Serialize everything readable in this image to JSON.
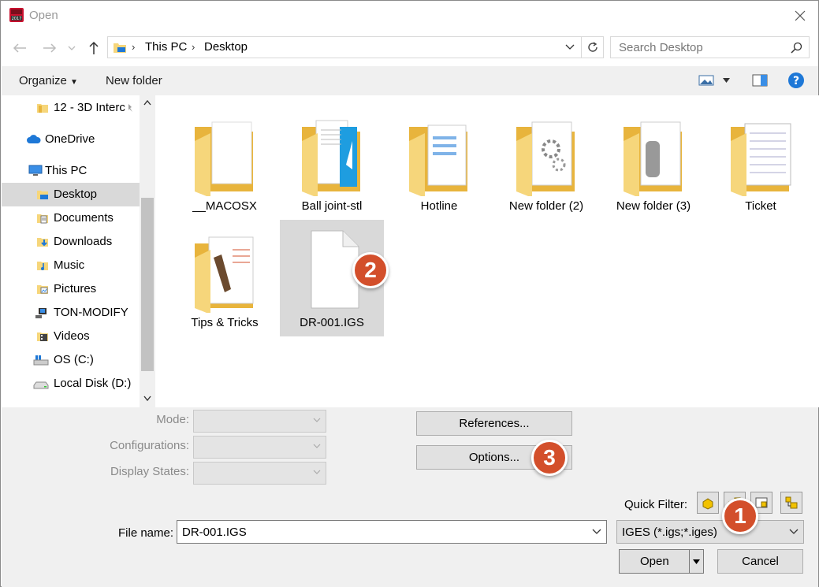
{
  "window": {
    "title": "Open"
  },
  "address": {
    "crumbs": [
      "This PC",
      "Desktop"
    ]
  },
  "search": {
    "placeholder": "Search Desktop"
  },
  "toolbar": {
    "organize_label": "Organize",
    "new_folder_label": "New folder"
  },
  "sidebar": {
    "items": [
      {
        "label": "12 - 3D Interc",
        "icon": "folder-icon"
      },
      {
        "label": "OneDrive",
        "icon": "cloud-icon"
      },
      {
        "label": "This PC",
        "icon": "computer-icon"
      },
      {
        "label": "Desktop",
        "icon": "desktop-folder-icon",
        "selected": true
      },
      {
        "label": "Documents",
        "icon": "documents-icon"
      },
      {
        "label": "Downloads",
        "icon": "downloads-icon"
      },
      {
        "label": "Music",
        "icon": "music-icon"
      },
      {
        "label": "Pictures",
        "icon": "pictures-icon"
      },
      {
        "label": "TON-MODIFY",
        "icon": "network-drive-icon"
      },
      {
        "label": "Videos",
        "icon": "videos-icon"
      },
      {
        "label": "OS (C:)",
        "icon": "windows-drive-icon"
      },
      {
        "label": "Local Disk (D:)",
        "icon": "disk-icon"
      }
    ]
  },
  "files": [
    {
      "name": "__MACOSX",
      "kind": "folder"
    },
    {
      "name": "Ball joint-stl",
      "kind": "folder"
    },
    {
      "name": "Hotline",
      "kind": "folder"
    },
    {
      "name": "New folder (2)",
      "kind": "folder"
    },
    {
      "name": "New folder (3)",
      "kind": "folder"
    },
    {
      "name": "Ticket",
      "kind": "folder"
    },
    {
      "name": "Tips & Tricks",
      "kind": "folder"
    },
    {
      "name": "DR-001.IGS",
      "kind": "file",
      "selected": true
    }
  ],
  "bottom": {
    "mode_label": "Mode:",
    "configurations_label": "Configurations:",
    "display_states_label": "Display States:",
    "references_label": "References...",
    "options_label": "Options...",
    "quick_filter_label": "Quick Filter:",
    "file_name_label": "File name:",
    "file_name_value": "DR-001.IGS",
    "filter_value": "IGES (*.igs;*.iges)",
    "open_label": "Open",
    "cancel_label": "Cancel"
  },
  "badges": [
    "1",
    "2",
    "3"
  ],
  "colors": {
    "badge": "#d34f2b",
    "folder": "#f6d67b",
    "selection": "#d9d9d9",
    "help": "#1e78d7"
  }
}
